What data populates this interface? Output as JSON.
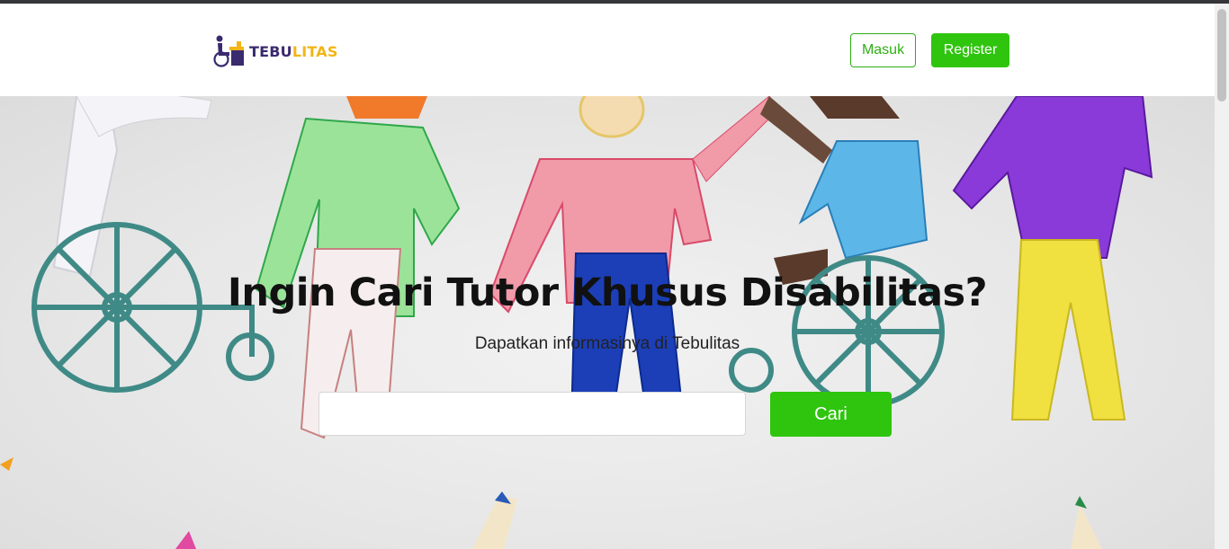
{
  "brand": {
    "part1": "TEBU",
    "part2": "LITAS",
    "logo_icon": "wheelchair-desk-icon"
  },
  "nav": {
    "login_label": "Masuk",
    "register_label": "Register"
  },
  "hero": {
    "title": "Ingin Cari Tutor Khusus Disabilitas?",
    "subtitle": "Dapatkan informasinya di Tebulitas",
    "search_value": "",
    "search_button": "Cari"
  },
  "colors": {
    "accent_green": "#2fc50e",
    "brand_purple": "#3a2a6e",
    "brand_yellow": "#f2b417"
  }
}
